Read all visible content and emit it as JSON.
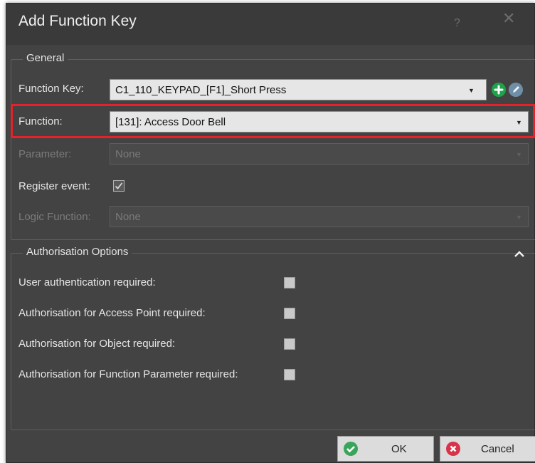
{
  "dialog": {
    "title": "Add Function Key",
    "help_label": "?",
    "close_label": "✕"
  },
  "general": {
    "legend": "General",
    "function_key_label": "Function Key:",
    "function_key_value": "C1_110_KEYPAD_[F1]_Short Press",
    "function_label": "Function:",
    "function_value": "[131]: Access Door Bell",
    "parameter_label": "Parameter:",
    "parameter_value": "None",
    "register_event_label": "Register event:",
    "register_event_checked": true,
    "logic_function_label": "Logic Function:",
    "logic_function_value": "None"
  },
  "authorisation": {
    "legend": "Authorisation Options",
    "options": [
      {
        "label": "User authentication required:",
        "checked": false
      },
      {
        "label": "Authorisation for Access Point required:",
        "checked": false
      },
      {
        "label": "Authorisation for Object required:",
        "checked": false
      },
      {
        "label": "Authorisation for Function Parameter required:",
        "checked": false
      }
    ]
  },
  "buttons": {
    "ok_label": "OK",
    "cancel_label": "Cancel"
  },
  "colors": {
    "dialog_bg": "#434343",
    "highlight_border": "#e3222b",
    "add_icon": "#1fa34a",
    "ok_icon": "#3aa55a",
    "cancel_icon": "#d9334a"
  },
  "icons": {
    "add": "plus-circle-icon",
    "edit": "pencil-circle-icon",
    "ok": "check-circle-icon",
    "cancel": "x-circle-icon",
    "collapse": "chevron-up-icon",
    "dropdown": "caret-down-icon"
  }
}
